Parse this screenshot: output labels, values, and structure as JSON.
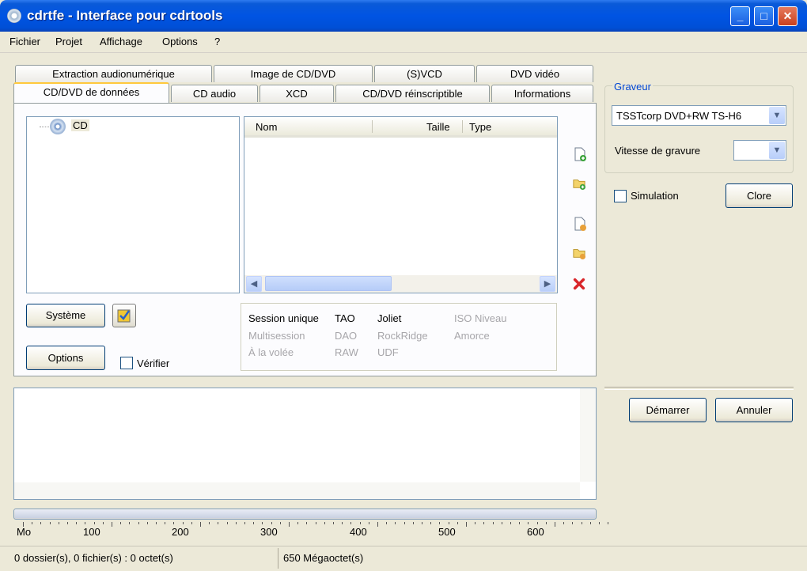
{
  "window": {
    "title": "cdrtfe - Interface pour cdrtools",
    "minimize": "_",
    "maximize": "□",
    "close": "✕"
  },
  "menu": [
    "Fichier",
    "Projet",
    "Affichage",
    "Options",
    "?"
  ],
  "tabs_row1": [
    "Extraction audionumérique",
    "Image de CD/DVD",
    "(S)VCD",
    "DVD vidéo"
  ],
  "tabs_row2": [
    "CD/DVD de données",
    "CD audio",
    "XCD",
    "CD/DVD réinscriptible",
    "Informations"
  ],
  "active_tab": "CD/DVD de données",
  "tree": {
    "root_label": "CD"
  },
  "filelist": {
    "columns": [
      "Nom",
      "Taille",
      "Type"
    ],
    "rows": []
  },
  "buttons": {
    "systeme": "Système",
    "options": "Options",
    "clore": "Clore",
    "demarrer": "Démarrer",
    "annuler": "Annuler"
  },
  "checkboxes": {
    "verifier": {
      "label": "Vérifier",
      "checked": false
    },
    "simulation": {
      "label": "Simulation",
      "checked": false
    }
  },
  "burn_options": {
    "col1": [
      {
        "label": "Session unique",
        "enabled": true
      },
      {
        "label": "Multisession",
        "enabled": false
      },
      {
        "label": "À la volée",
        "enabled": false
      }
    ],
    "col2": [
      {
        "label": "TAO",
        "enabled": true
      },
      {
        "label": "DAO",
        "enabled": false
      },
      {
        "label": "RAW",
        "enabled": false
      }
    ],
    "col3": [
      {
        "label": "Joliet",
        "enabled": true
      },
      {
        "label": "RockRidge",
        "enabled": false
      },
      {
        "label": "UDF",
        "enabled": false
      }
    ],
    "col4": [
      {
        "label": "ISO Niveau",
        "enabled": false
      },
      {
        "label": "Amorce",
        "enabled": false
      }
    ]
  },
  "graveur": {
    "legend": "Graveur",
    "device": "TSSTcorp DVD+RW TS-H6",
    "speed_label": "Vitesse de gravure",
    "speed_value": ""
  },
  "ruler": {
    "unit": "Mo",
    "labels": [
      "100",
      "200",
      "300",
      "400",
      "500",
      "600"
    ]
  },
  "status": {
    "files": "0 dossier(s), 0 fichier(s) : 0 octet(s)",
    "capacity": "650 Mégaoctet(s)"
  },
  "colors": {
    "titlebar": "#0054e3",
    "window_bg": "#ece9d8",
    "delete_icon": "#d9262b",
    "legend": "#0046d5"
  },
  "icons": [
    "cd-app-icon",
    "cd-tree-icon",
    "add-file-icon",
    "add-folder-icon",
    "remove-file-icon",
    "remove-folder-icon",
    "delete-icon",
    "check-tool-icon"
  ]
}
